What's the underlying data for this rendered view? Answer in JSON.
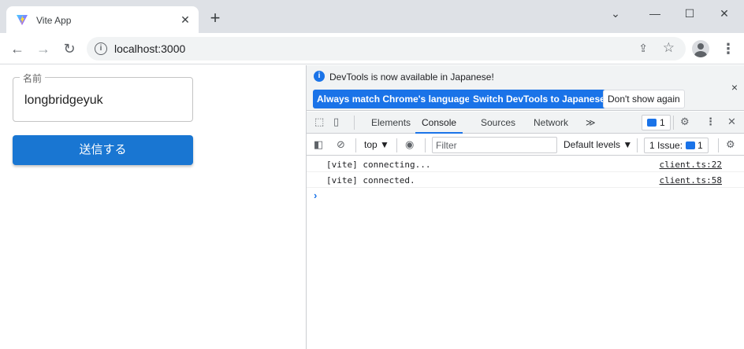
{
  "browser": {
    "tab_title": "Vite App",
    "tab_close": "✕",
    "new_tab": "+",
    "url": "localhost:3000",
    "window_controls": [
      "⌄",
      "—",
      "☐",
      "✕"
    ],
    "nav": {
      "back": "←",
      "forward": "→",
      "reload": "↻"
    },
    "menu": "⋮"
  },
  "form": {
    "name_label": "名前",
    "name_value": "longbridgeyuk",
    "submit_label": "送信する"
  },
  "devtools": {
    "infobar_message": "DevTools is now available in Japanese!",
    "btn_match": "Always match Chrome's language",
    "btn_switch": "Switch DevTools to Japanese",
    "btn_dismiss": "Don't show again",
    "close": "×",
    "tabs": [
      "Elements",
      "Console",
      "Sources",
      "Network"
    ],
    "more_tabs": "≫",
    "active_tab": "Console",
    "issue_count": "1",
    "context": "top ▼",
    "filter_placeholder": "Filter",
    "levels": "Default levels ▼",
    "issues_label": "1 Issue:",
    "logs": [
      {
        "text": "[vite] connecting...",
        "source": "client.ts:22"
      },
      {
        "text": "[vite] connected.",
        "source": "client.ts:58"
      }
    ],
    "prompt": "›"
  },
  "colors": {
    "accent": "#1a73e8",
    "button": "#1976d2"
  }
}
